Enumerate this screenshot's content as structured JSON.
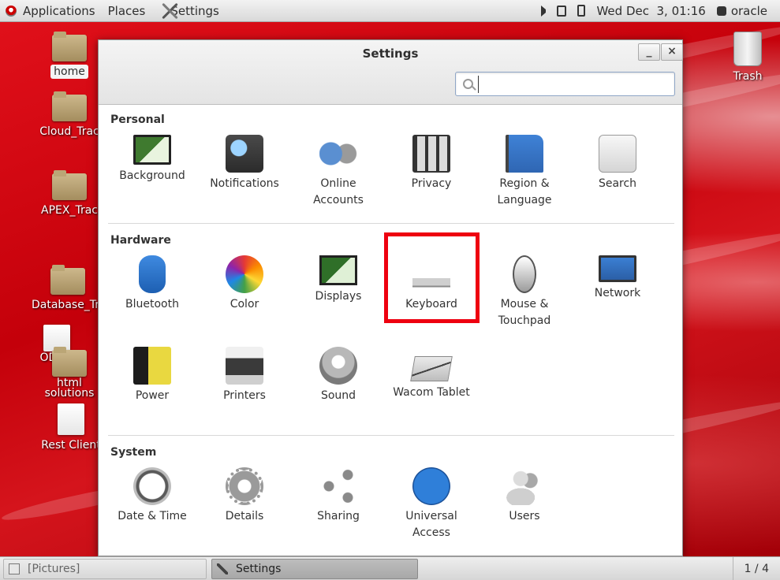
{
  "topbar": {
    "applications": "Applications",
    "places": "Places",
    "active_app": "Settings",
    "clock": "Wed Dec  3, 01:16",
    "user": "oracle"
  },
  "desktop": {
    "icons": [
      {
        "label": "home",
        "kind": "home-folder"
      },
      {
        "label": "Cloud_Trac",
        "kind": "folder"
      },
      {
        "label": "APEX_Trac",
        "kind": "folder"
      },
      {
        "label": "Database_Tra",
        "kind": "folder"
      },
      {
        "label": "ODDH",
        "kind": "document"
      },
      {
        "label": "html",
        "kind": "folder"
      },
      {
        "label": "solutions",
        "kind": "folder"
      },
      {
        "label": "Rest Client",
        "kind": "document"
      },
      {
        "label": "Trash",
        "kind": "trash"
      }
    ]
  },
  "window": {
    "title": "Settings",
    "minimize": "_",
    "close": "×",
    "search_placeholder": ""
  },
  "sections": {
    "personal": {
      "title": "Personal",
      "items": [
        "Background",
        "Notifications",
        "Online\nAccounts",
        "Privacy",
        "Region &\nLanguage",
        "Search"
      ]
    },
    "hardware": {
      "title": "Hardware",
      "items": [
        "Bluetooth",
        "Color",
        "Displays",
        "Keyboard",
        "Mouse &\nTouchpad",
        "Network",
        "Power",
        "Printers",
        "Sound",
        "Wacom Tablet"
      ]
    },
    "system": {
      "title": "System",
      "items": [
        "Date & Time",
        "Details",
        "Sharing",
        "Universal\nAccess",
        "Users"
      ]
    }
  },
  "highlighted_item": "Keyboard",
  "highlight_color": "#ee0010",
  "taskbar": {
    "tasks": [
      {
        "label": "[Pictures]",
        "active": false
      },
      {
        "label": "Settings",
        "active": true
      }
    ],
    "workspace": "1 / 4"
  }
}
